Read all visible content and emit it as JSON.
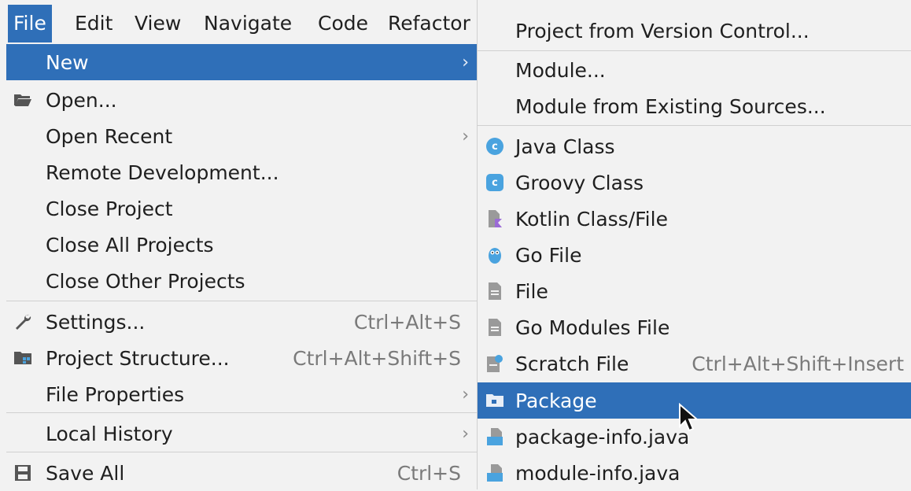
{
  "menubar": {
    "items": [
      {
        "label": "File",
        "active": true
      },
      {
        "label": "Edit"
      },
      {
        "label": "View"
      },
      {
        "label": "Navigate"
      },
      {
        "label": "Code"
      },
      {
        "label": "Refactor"
      }
    ]
  },
  "file_menu": {
    "items": [
      {
        "label": "New",
        "has_submenu": true,
        "selected": true
      },
      {
        "label": "Open...",
        "icon": "folder-open-icon"
      },
      {
        "label": "Open Recent",
        "has_submenu": true
      },
      {
        "label": "Remote Development..."
      },
      {
        "label": "Close Project"
      },
      {
        "label": "Close All Projects"
      },
      {
        "label": "Close Other Projects"
      },
      {
        "label": "Settings...",
        "icon": "wrench-icon",
        "shortcut": "Ctrl+Alt+S"
      },
      {
        "label": "Project Structure...",
        "icon": "project-structure-icon",
        "shortcut": "Ctrl+Alt+Shift+S"
      },
      {
        "label": "File Properties",
        "has_submenu": true
      },
      {
        "label": "Local History",
        "has_submenu": true
      },
      {
        "label": "Save All",
        "icon": "save-icon",
        "shortcut": "Ctrl+S"
      }
    ]
  },
  "new_submenu": {
    "items": [
      {
        "label": "Project from Version Control..."
      },
      {
        "label": "Module..."
      },
      {
        "label": "Module from Existing Sources..."
      },
      {
        "label": "Java Class",
        "icon": "java-class-icon",
        "icon_text": "c"
      },
      {
        "label": "Groovy Class",
        "icon": "groovy-class-icon",
        "icon_text": "c"
      },
      {
        "label": "Kotlin Class/File",
        "icon": "kotlin-file-icon"
      },
      {
        "label": "Go File",
        "icon": "go-file-icon"
      },
      {
        "label": "File",
        "icon": "file-icon"
      },
      {
        "label": "Go Modules File",
        "icon": "go-modules-file-icon"
      },
      {
        "label": "Scratch File",
        "icon": "scratch-file-icon",
        "shortcut": "Ctrl+Alt+Shift+Insert"
      },
      {
        "label": "Package",
        "icon": "package-folder-icon",
        "selected": true
      },
      {
        "label": "package-info.java",
        "icon": "java-file-icon"
      },
      {
        "label": "module-info.java",
        "icon": "java-file-icon"
      }
    ]
  },
  "colors": {
    "selection": "#2f6fb8",
    "background": "#f2f2f2",
    "shortcut": "#7a7a7a",
    "icon_blue": "#4aa3df"
  }
}
